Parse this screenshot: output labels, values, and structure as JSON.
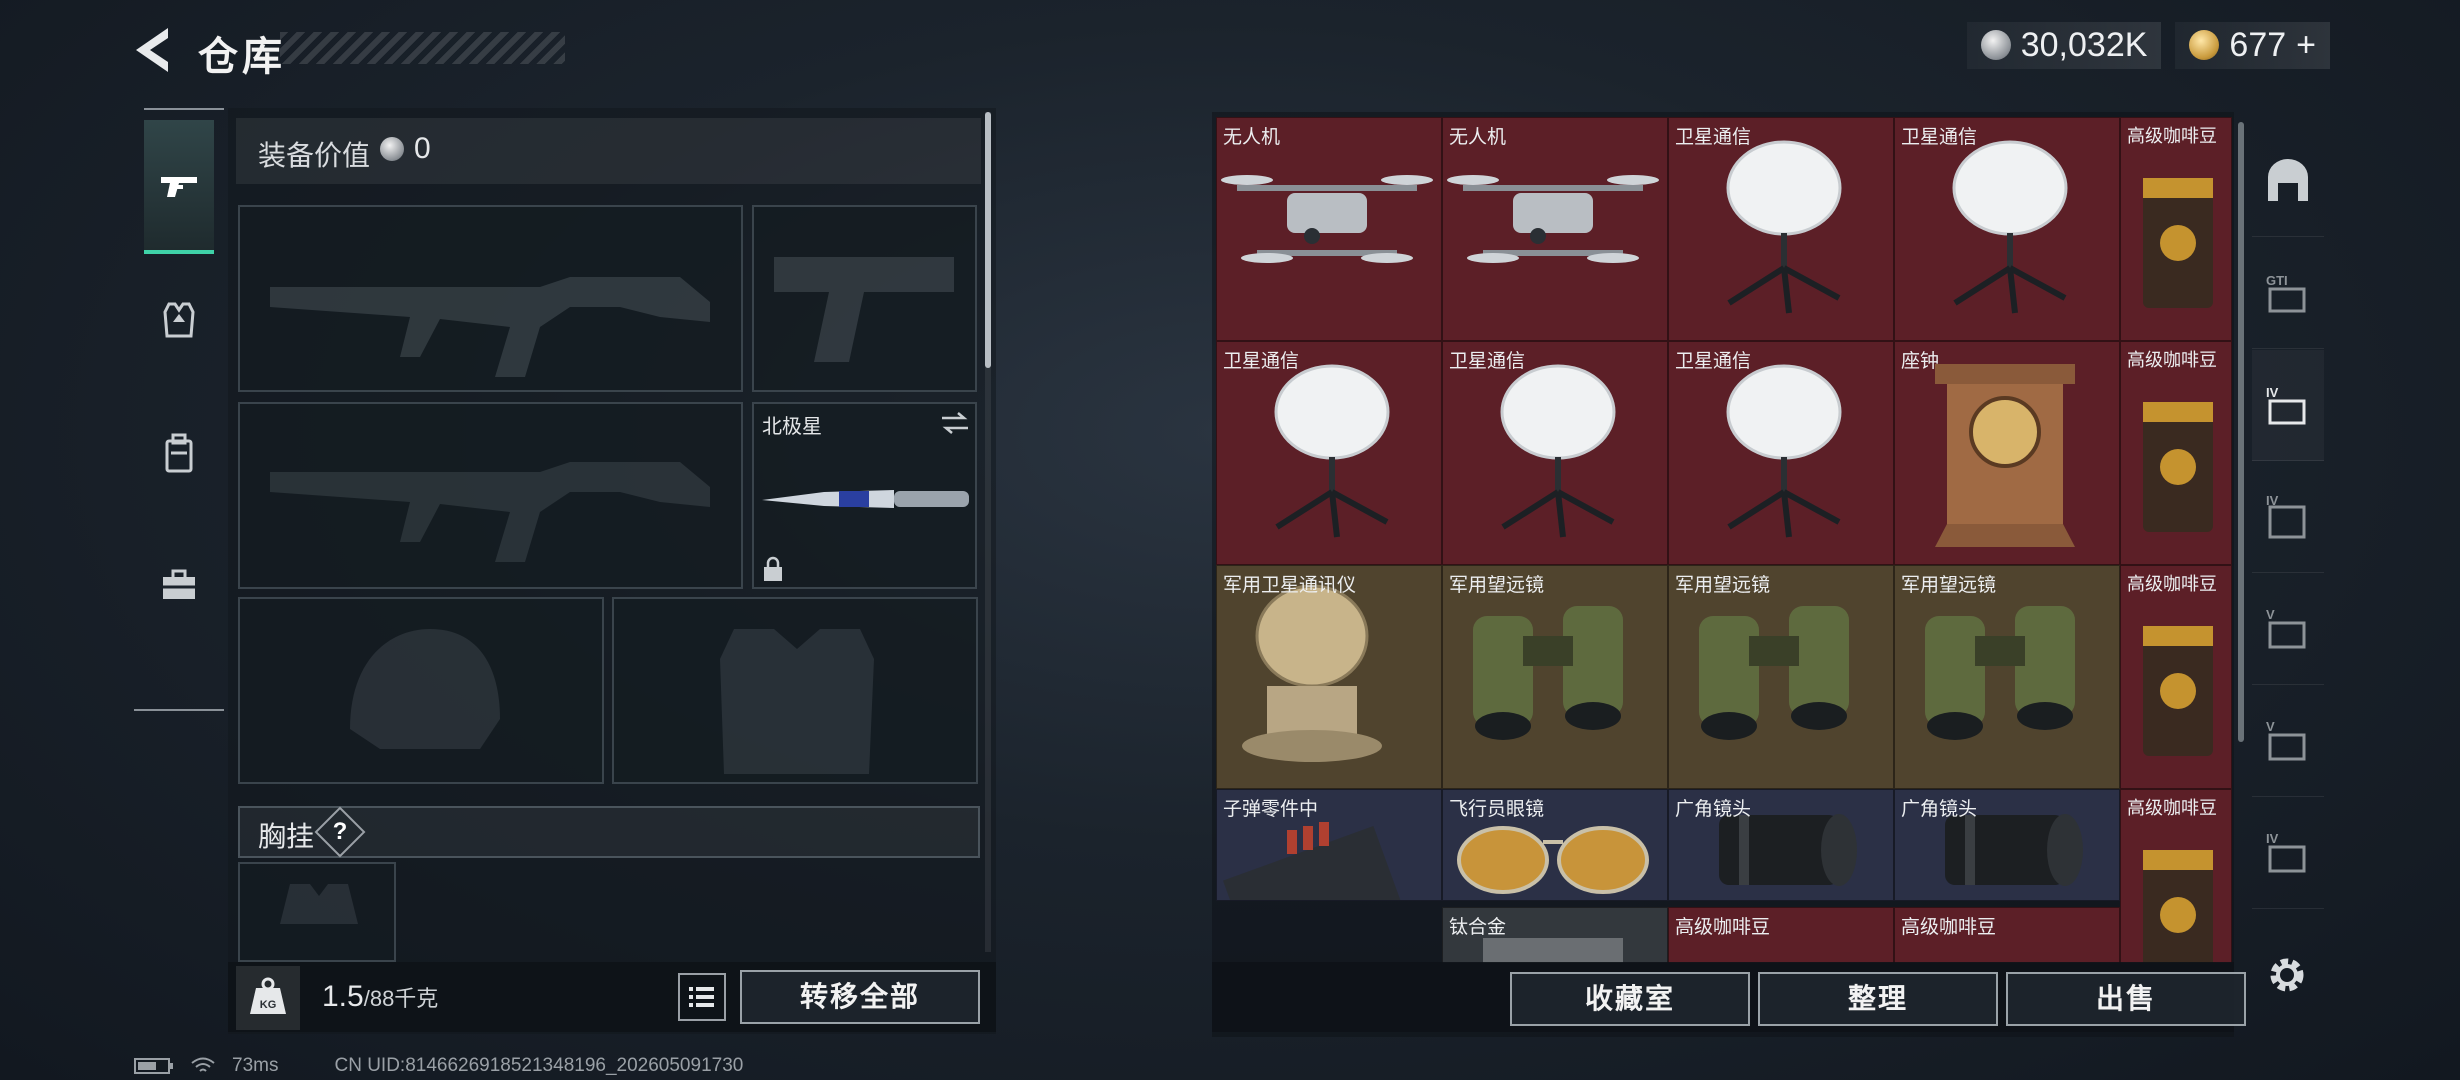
{
  "header": {
    "title": "仓库"
  },
  "currency": {
    "silver": "30,032K",
    "gold": "677",
    "gold_plus": "+"
  },
  "equipment": {
    "value_label": "装备价值",
    "value": "0",
    "knife_name": "北极星",
    "chest_label": "胸挂",
    "chest_help": "?"
  },
  "bottom_left": {
    "weight": "1.5",
    "weight_max": "/88千克",
    "transfer_all": "转移全部"
  },
  "inventory": {
    "items": [
      {
        "label": "无人机",
        "icon": "drone-icon",
        "rarity": "red"
      },
      {
        "label": "无人机",
        "icon": "drone-icon",
        "rarity": "red"
      },
      {
        "label": "卫星通信",
        "icon": "satellite-dish-icon",
        "rarity": "red"
      },
      {
        "label": "卫星通信",
        "icon": "satellite-dish-icon",
        "rarity": "red"
      },
      {
        "label": "高级咖啡豆",
        "icon": "coffee-bag-icon",
        "rarity": "red"
      },
      {
        "label": "卫星通信",
        "icon": "satellite-dish-icon",
        "rarity": "red"
      },
      {
        "label": "卫星通信",
        "icon": "satellite-dish-icon",
        "rarity": "red"
      },
      {
        "label": "卫星通信",
        "icon": "satellite-dish-icon",
        "rarity": "red"
      },
      {
        "label": "座钟",
        "icon": "clock-icon",
        "rarity": "red"
      },
      {
        "label": "高级咖啡豆",
        "icon": "coffee-bag-icon",
        "rarity": "red"
      },
      {
        "label": "军用卫星通讯仪",
        "icon": "military-satcom-icon",
        "rarity": "gold"
      },
      {
        "label": "军用望远镜",
        "icon": "binoculars-icon",
        "rarity": "gold"
      },
      {
        "label": "军用望远镜",
        "icon": "binoculars-icon",
        "rarity": "gold"
      },
      {
        "label": "军用望远镜",
        "icon": "binoculars-icon",
        "rarity": "gold"
      },
      {
        "label": "高级咖啡豆",
        "icon": "coffee-bag-icon",
        "rarity": "red"
      },
      {
        "label": "子弹零件中",
        "icon": "ammo-parts-icon",
        "rarity": "blue"
      },
      {
        "label": "飞行员眼镜",
        "icon": "aviator-glasses-icon",
        "rarity": "blue"
      },
      {
        "label": "广角镜头",
        "icon": "camera-lens-icon",
        "rarity": "blue"
      },
      {
        "label": "广角镜头",
        "icon": "camera-lens-icon",
        "rarity": "blue"
      },
      {
        "label": "高级咖啡豆",
        "icon": "coffee-bag-icon",
        "rarity": "red"
      },
      {
        "label": "钛合金",
        "icon": "titanium-plate-icon",
        "rarity": "gray"
      },
      {
        "label": "高级咖啡豆",
        "icon": "coffee-bag-icon",
        "rarity": "red"
      },
      {
        "label": "高级咖啡豆",
        "icon": "coffee-bag-icon",
        "rarity": "red"
      }
    ]
  },
  "bottom_right": {
    "collection": "收藏室",
    "sort": "整理",
    "sell": "出售"
  },
  "status": {
    "ping": "73ms",
    "uid": "CN UID:8146626918521348196_202605091730"
  },
  "colors": {
    "accent": "#3fd2a8",
    "red_rarity": "#5c1f27",
    "gold_rarity": "#50442e",
    "blue_rarity": "#2b3046"
  }
}
